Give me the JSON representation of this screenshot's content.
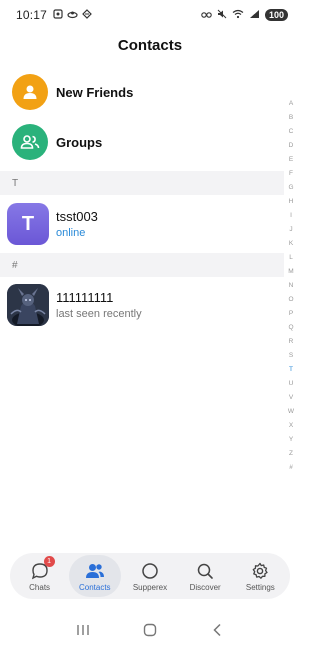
{
  "status_bar": {
    "time": "10:17",
    "battery": "100"
  },
  "header": {
    "title": "Contacts"
  },
  "special_items": [
    {
      "label": "New Friends",
      "icon": "person-icon",
      "color": "#f2a114"
    },
    {
      "label": "Groups",
      "icon": "group-icon",
      "color": "#2ab27b"
    }
  ],
  "sections": [
    {
      "letter": "T",
      "contacts": [
        {
          "name": "tsst003",
          "status": "online",
          "avatar_letter": "T",
          "avatar_type": "letter"
        }
      ]
    },
    {
      "letter": "#",
      "contacts": [
        {
          "name": "111111111",
          "status": "last seen recently",
          "avatar_type": "image"
        }
      ]
    }
  ],
  "index_letters": [
    "A",
    "B",
    "C",
    "D",
    "E",
    "F",
    "G",
    "H",
    "I",
    "J",
    "K",
    "L",
    "M",
    "N",
    "O",
    "P",
    "Q",
    "R",
    "S",
    "T",
    "U",
    "V",
    "W",
    "X",
    "Y",
    "Z",
    "#"
  ],
  "active_index": "T",
  "tabs": [
    {
      "label": "Chats",
      "icon": "chat-bubble-icon",
      "badge": "1",
      "active": false
    },
    {
      "label": "Contacts",
      "icon": "contacts-icon",
      "active": true
    },
    {
      "label": "Supperex",
      "icon": "circle-icon",
      "active": false
    },
    {
      "label": "Discover",
      "icon": "search-icon",
      "active": false
    },
    {
      "label": "Settings",
      "icon": "gear-icon",
      "active": false
    }
  ],
  "colors": {
    "accent": "#2a8ad8",
    "active_tab": "#2a6fd8",
    "badge": "#e14a4a",
    "avatar_letter_bg": "#7766de"
  }
}
